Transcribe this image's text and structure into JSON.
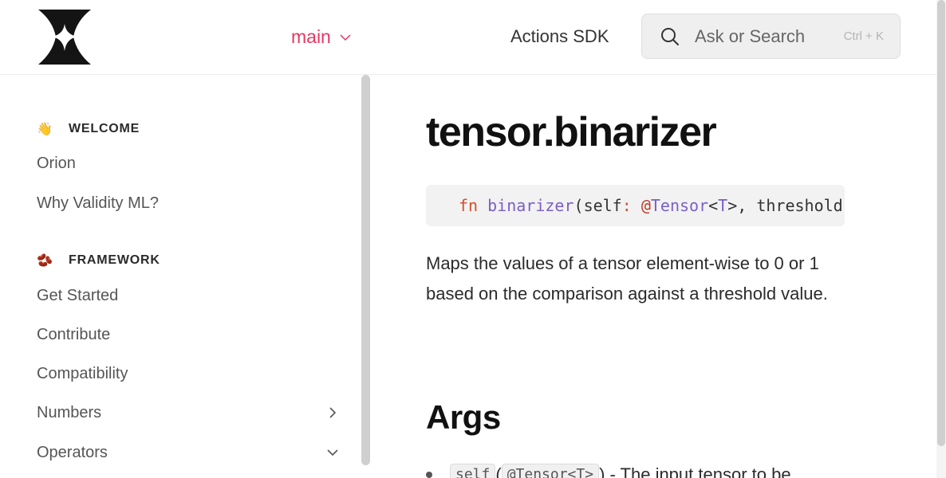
{
  "header": {
    "logo_icon": "four-point-star-logo-icon",
    "version_label": "main",
    "nav_link": "Actions SDK",
    "search": {
      "placeholder": "Ask or Search",
      "shortcut": "Ctrl + K"
    }
  },
  "sidebar": {
    "sections": [
      {
        "emoji": "👋",
        "title": "WELCOME",
        "items": [
          {
            "label": "Orion"
          },
          {
            "label": "Why Validity ML?"
          }
        ]
      },
      {
        "emoji": "🫘",
        "title": "FRAMEWORK",
        "items": [
          {
            "label": "Get Started"
          },
          {
            "label": "Contribute"
          },
          {
            "label": "Compatibility"
          },
          {
            "label": "Numbers",
            "chevron": "right"
          },
          {
            "label": "Operators",
            "chevron": "down"
          }
        ]
      }
    ]
  },
  "main": {
    "title": "tensor.binarizer",
    "signature": {
      "kw": "fn",
      "name": "binarizer",
      "open": "(",
      "self": "self",
      "colon": ":",
      "at": "@",
      "tensor": "Tensor",
      "lt": "<",
      "T": "T",
      "gt_rest": ">, threshold"
    },
    "description": "Maps the values of a tensor element-wise to 0 or 1 based on the comparison against a threshold value.",
    "args_heading": "Args",
    "arg": {
      "name": "self",
      "paren_open": "(",
      "type": "@Tensor<T>",
      "rest": ") - The input tensor to be"
    }
  }
}
